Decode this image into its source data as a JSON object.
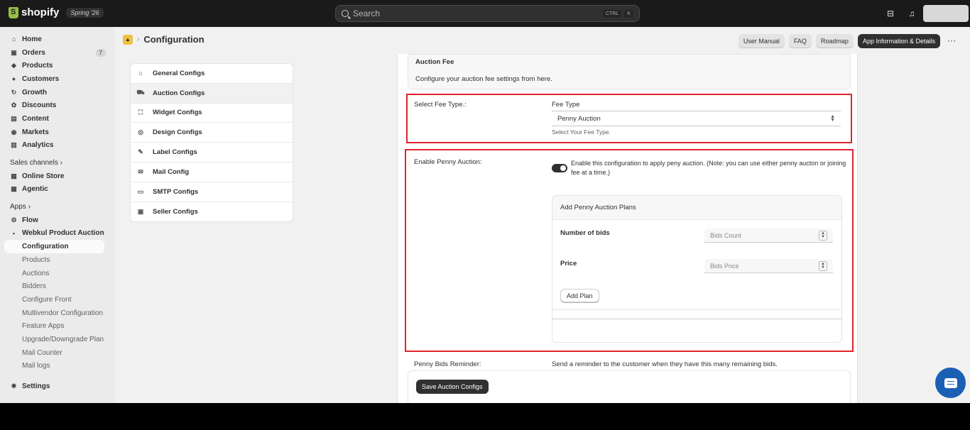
{
  "topbar": {
    "brand": "shopify",
    "edition": "Spring '26",
    "search_placeholder": "Search",
    "shortcut_key1": "CTRL",
    "shortcut_key2": "K"
  },
  "sidebar": {
    "main_items": [
      {
        "label": "Home",
        "icon": "home-icon"
      },
      {
        "label": "Orders",
        "icon": "orders-icon",
        "count": "7"
      },
      {
        "label": "Products",
        "icon": "tag-icon"
      },
      {
        "label": "Customers",
        "icon": "person-icon"
      },
      {
        "label": "Growth",
        "icon": "growth-icon"
      },
      {
        "label": "Discounts",
        "icon": "discount-icon"
      },
      {
        "label": "Content",
        "icon": "content-icon"
      },
      {
        "label": "Markets",
        "icon": "globe-icon"
      },
      {
        "label": "Analytics",
        "icon": "chart-icon"
      }
    ],
    "sales_channels_label": "Sales channels",
    "channels": [
      {
        "label": "Online Store",
        "icon": "store-icon"
      },
      {
        "label": "Agentic",
        "icon": "agentic-icon"
      }
    ],
    "apps_label": "Apps",
    "apps": [
      {
        "label": "Flow",
        "icon": "flow-icon"
      },
      {
        "label": "Webkul Product Auction",
        "icon": "app-icon"
      }
    ],
    "sub_items": [
      {
        "label": "Configuration"
      },
      {
        "label": "Products"
      },
      {
        "label": "Auctions"
      },
      {
        "label": "Bidders"
      },
      {
        "label": "Configure Front"
      },
      {
        "label": "Multivendor Configuration"
      },
      {
        "label": "Feature Apps"
      },
      {
        "label": "Upgrade/Downgrade Plan"
      },
      {
        "label": "Mail Counter"
      },
      {
        "label": "Mail logs"
      }
    ],
    "settings_label": "Settings"
  },
  "header": {
    "title": "Configuration",
    "buttons": {
      "manual": "User Manual",
      "faq": "FAQ",
      "roadmap": "Roadmap",
      "app_info": "App Information & Details"
    }
  },
  "config_menu": [
    {
      "label": "General Configs",
      "icon": "home-icon"
    },
    {
      "label": "Auction Configs",
      "icon": "cart-icon"
    },
    {
      "label": "Widget Configs",
      "icon": "widget-icon"
    },
    {
      "label": "Design Configs",
      "icon": "eye-icon"
    },
    {
      "label": "Label Configs",
      "icon": "label-icon"
    },
    {
      "label": "Mail Config",
      "icon": "mail-icon"
    },
    {
      "label": "SMTP Configs",
      "icon": "smtp-icon"
    },
    {
      "label": "Seller Configs",
      "icon": "seller-icon"
    }
  ],
  "fee_section": {
    "title": "Auction Fee",
    "description": "Configure your auction fee settings from here."
  },
  "fee_type": {
    "row_label": "Select Fee Type.:",
    "field_label": "Fee Type",
    "selected": "Penny Auction",
    "help": "Select Your Fee Type."
  },
  "penny": {
    "row_label": "Enable Penny Auction:",
    "toggle_on": true,
    "toggle_text": "Enable this configuration to apply peny auction. (Note: you can use either penny aucton or joining fee at a time.)",
    "plans_title": "Add Penny Auction Plans",
    "bids_label": "Number of bids",
    "bids_placeholder": "Bids Count",
    "price_label": "Price",
    "price_placeholder": "Bids Price",
    "add_plan": "Add Plan"
  },
  "reminder": {
    "label": "Penny Bids Reminder:",
    "text": "Send a reminder to the customer when they have this many remaining bids."
  },
  "save_button": "Save Auction Configs"
}
